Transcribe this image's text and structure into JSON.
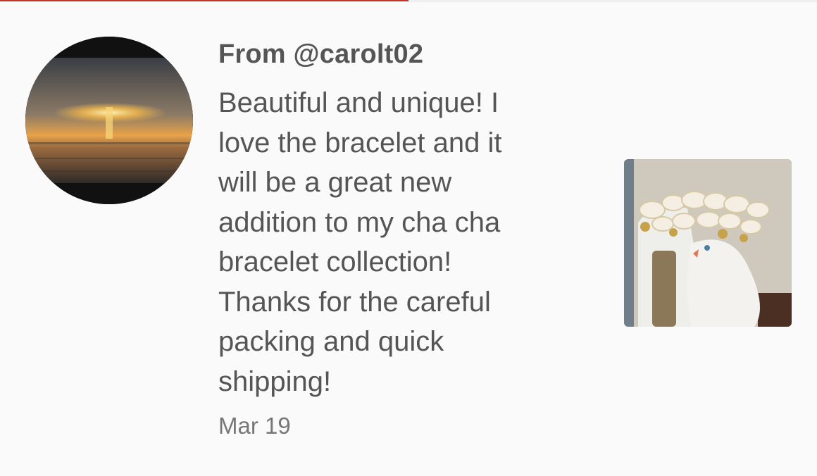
{
  "review": {
    "from_label": "From @carolt02",
    "text": "Beautiful and unique! I\nlove the bracelet and it\nwill be a great new\naddition to my cha cha\nbracelet collection!\nThanks for the careful\npacking and quick\nshipping!",
    "date": "Mar 19"
  },
  "icons": {
    "avatar": "reviewer-avatar-sunset",
    "photo": "review-photo-bracelet"
  },
  "colors": {
    "text": "#555555",
    "date": "#777777",
    "background": "#fafafa",
    "progress_accent": "#c4342d"
  }
}
